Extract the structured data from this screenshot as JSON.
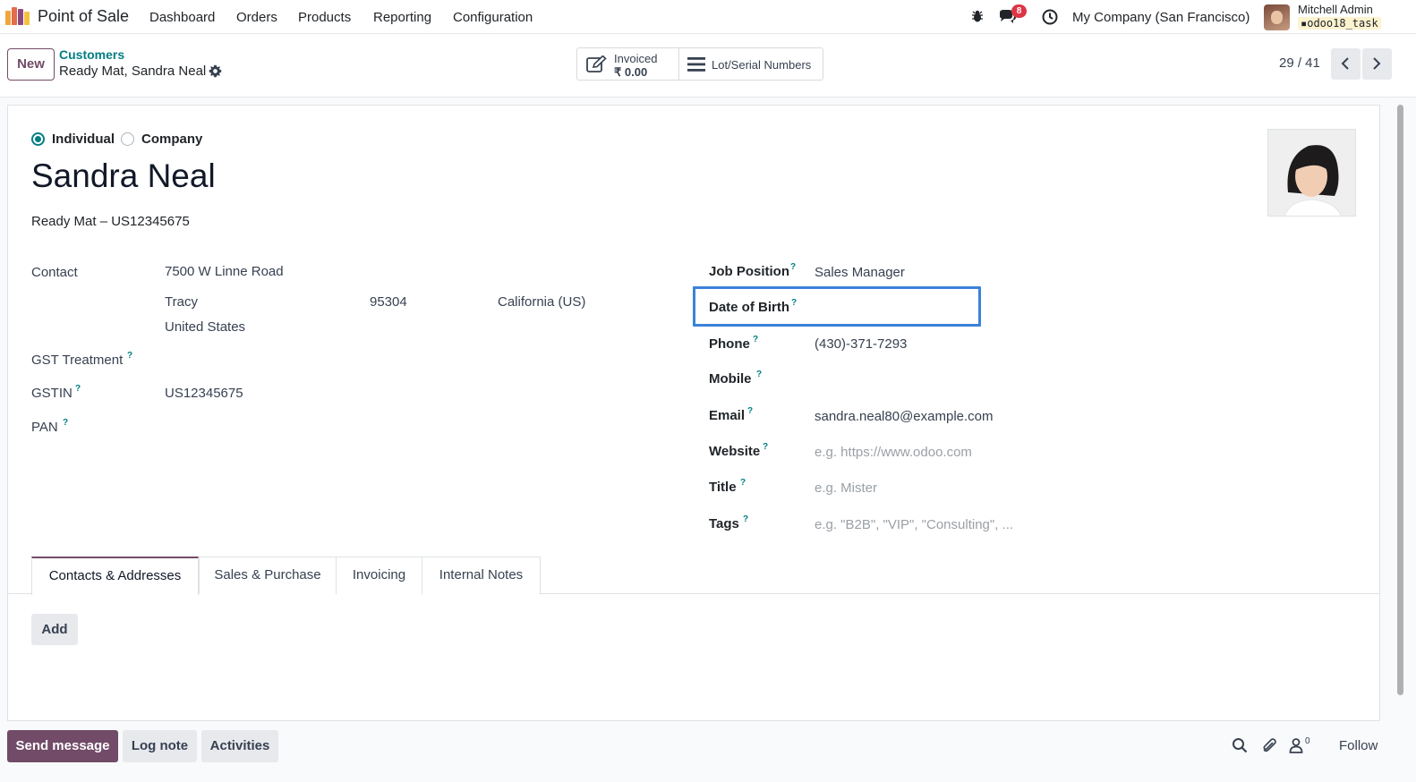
{
  "topbar": {
    "app_name": "Point of Sale",
    "menu": [
      "Dashboard",
      "Orders",
      "Products",
      "Reporting",
      "Configuration"
    ],
    "messages_badge": "8",
    "company": "My Company (San Francisco)",
    "user_name": "Mitchell Admin",
    "database": "odoo18_task",
    "icons": [
      "debug-icon",
      "chat-icon",
      "clock-icon"
    ]
  },
  "control": {
    "new_label": "New",
    "breadcrumb_parent": "Customers",
    "breadcrumb_current": "Ready Mat, Sandra Neal",
    "invoiced_label": "Invoiced",
    "invoiced_value": "₹ 0.00",
    "lots_label": "Lot/Serial Numbers",
    "pager": "29 / 41"
  },
  "form": {
    "type_individual": "Individual",
    "type_company": "Company",
    "selected_type": "Individual",
    "name": "Sandra Neal",
    "subtitle": "Ready Mat – US12345675",
    "left": {
      "contact_label": "Contact",
      "street": "7500 W Linne Road",
      "city": "Tracy",
      "zip": "95304",
      "state": "California (US)",
      "country": "United States",
      "gst_treatment_label": "GST Treatment",
      "gstin_label": "GSTIN",
      "gstin_value": "US12345675",
      "pan_label": "PAN"
    },
    "right": {
      "job_position_label": "Job Position",
      "job_position_value": "Sales Manager",
      "dob_label": "Date of Birth",
      "phone_label": "Phone",
      "phone_value": "(430)-371-7293",
      "mobile_label": "Mobile",
      "email_label": "Email",
      "email_value": "sandra.neal80@example.com",
      "website_label": "Website",
      "website_placeholder": "e.g. https://www.odoo.com",
      "title_label": "Title",
      "title_placeholder": "e.g. Mister",
      "tags_label": "Tags",
      "tags_placeholder": "e.g. \"B2B\", \"VIP\", \"Consulting\", ..."
    },
    "help_mark": "?"
  },
  "tabs": [
    "Contacts & Addresses",
    "Sales & Purchase",
    "Invoicing",
    "Internal Notes"
  ],
  "add_label": "Add",
  "chatter": {
    "send_message": "Send message",
    "log_note": "Log note",
    "activities": "Activities",
    "followers": "0",
    "follow": "Follow"
  },
  "colors": {
    "brand": "#714b67",
    "accent": "#017e84",
    "highlight": "#3b82d9",
    "badge": "#dc3545"
  }
}
